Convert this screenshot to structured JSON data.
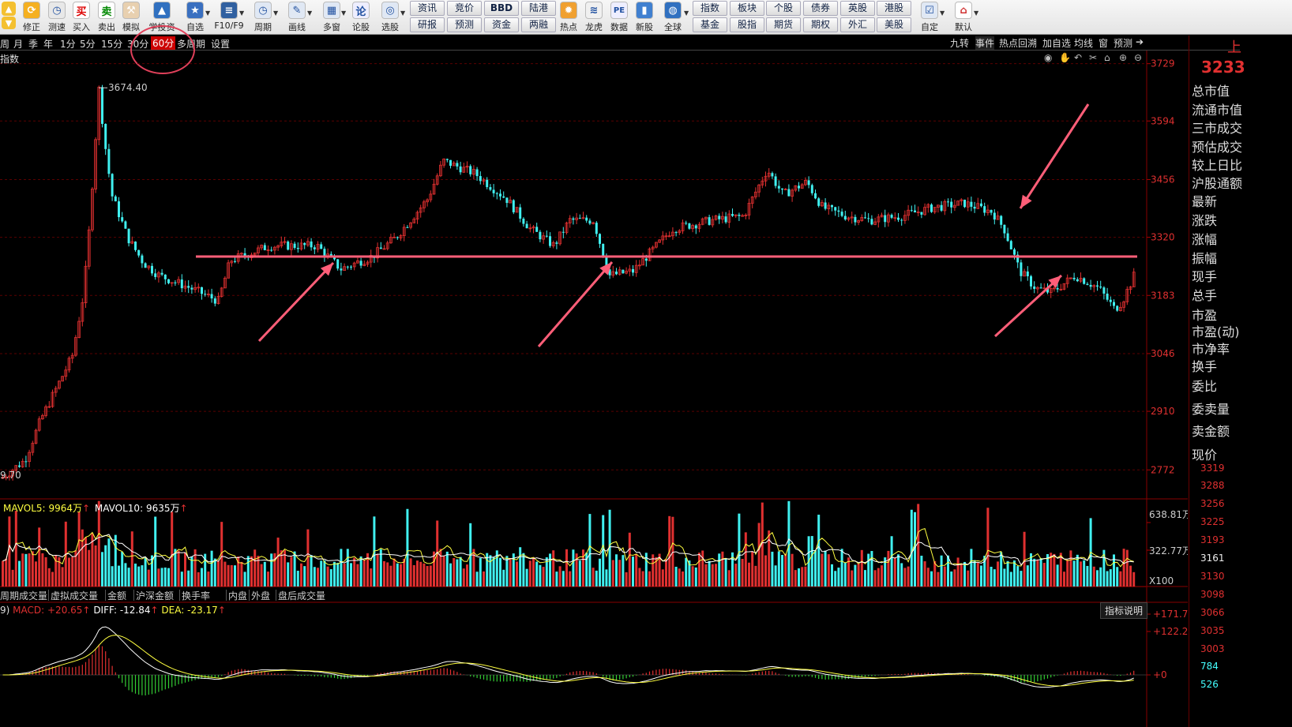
{
  "toolbar": {
    "buttons": [
      {
        "label": "修正",
        "icon": "refresh-icon"
      },
      {
        "label": "测速",
        "icon": "clock-icon"
      },
      {
        "label": "买入",
        "glyph": "买"
      },
      {
        "label": "卖出",
        "glyph": "卖"
      },
      {
        "label": "模拟",
        "icon": "hammer-icon"
      },
      {
        "label": "学投资",
        "icon": "graduation-icon"
      },
      {
        "label": "自选",
        "icon": "star-folder-icon"
      },
      {
        "label": "F10/F9",
        "icon": "f10-icon"
      },
      {
        "label": "周期",
        "icon": "period-icon"
      },
      {
        "label": "画线",
        "icon": "pencil-icon"
      },
      {
        "label": "多窗",
        "icon": "multiwindow-icon"
      },
      {
        "label": "论股",
        "glyph": "论"
      },
      {
        "label": "选股",
        "icon": "select-stock-icon"
      },
      {
        "label": "热点",
        "icon": "hot-icon"
      },
      {
        "label": "龙虎",
        "icon": "dragon-icon"
      },
      {
        "label": "数据",
        "glyph": "PE"
      },
      {
        "label": "新股",
        "icon": "newstock-icon"
      },
      {
        "label": "全球",
        "icon": "globe-icon"
      },
      {
        "label": "自定",
        "icon": "custom-icon"
      },
      {
        "label": "默认",
        "icon": "home-icon"
      }
    ],
    "grid_row1": [
      "资讯",
      "竞价",
      "BBD",
      "陆港",
      "指数",
      "板块",
      "个股",
      "债券",
      "英股",
      "港股"
    ],
    "grid_row2": [
      "研报",
      "预测",
      "资金",
      "两融",
      "基金",
      "股指",
      "期货",
      "期权",
      "外汇",
      "美股"
    ]
  },
  "periodbar": {
    "periods": [
      "周",
      "月",
      "季",
      "年",
      "1分",
      "5分",
      "15分",
      "30分",
      "60分",
      "多周期",
      "设置"
    ],
    "active": "60分",
    "right_tabs": [
      "九转",
      "事件",
      "热点回溯",
      "加自选",
      "均线",
      "窗",
      "预测"
    ]
  },
  "main_chart": {
    "title": "指数",
    "high_label": "3674.40",
    "low_label": "9.70",
    "y_ticks": [
      "3729",
      "3594",
      "3456",
      "3320",
      "3183",
      "3046",
      "2910",
      "2772"
    ]
  },
  "volume_pane": {
    "mavol5_label": "MAVOL5:",
    "mavol5_value": "9964万",
    "mavol10_label": "MAVOL10:",
    "mavol10_value": "9635万",
    "y_ticks": [
      "638.81万",
      "322.77万",
      "X100"
    ]
  },
  "subtabs": [
    "周期成交量",
    "虚拟成交量",
    "金额",
    "沪深金额",
    "换手率",
    "内盘",
    "外盘",
    "盘后成交量"
  ],
  "macd_pane": {
    "prefix": "9)",
    "macd_label": "MACD:",
    "macd_value": "+20.65",
    "diff_label": "DIFF:",
    "diff_value": "-12.84",
    "dea_label": "DEA:",
    "dea_value": "-23.17",
    "info_button": "指标说明",
    "y_ticks": [
      "+171.7",
      "+122.2",
      "+0"
    ]
  },
  "right_panel": {
    "top_char": "上",
    "price": "3233",
    "items": [
      "总市值",
      "流通市值",
      "三市成交",
      "预估成交",
      "较上日比",
      "沪股通额",
      "最新",
      "涨跌",
      "涨幅",
      "振幅",
      "现手",
      "总手",
      "市盈",
      "市盈(动)",
      "市净率",
      "换手",
      "委比",
      "委卖量",
      "卖金额",
      "现价"
    ],
    "price_ticks": [
      "3319",
      "3288",
      "3256",
      "3225",
      "3193",
      "3161",
      "3130",
      "3098",
      "3066",
      "3035",
      "3003",
      "784",
      "526"
    ]
  },
  "colors": {
    "up": "#e03030",
    "down": "#40f0f0",
    "support_line": "#ff5e78",
    "ma_white": "#ffffff",
    "ma_yellow": "#ffff40"
  }
}
